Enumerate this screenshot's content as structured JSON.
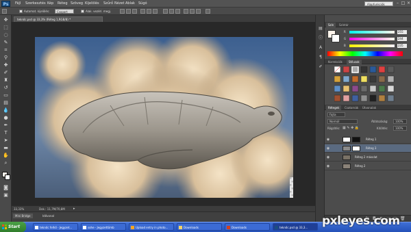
{
  "app": {
    "logo": "Ps",
    "menu": [
      "Fájl",
      "Szerkesztés",
      "Kép",
      "Réteg",
      "Szöveg",
      "Kijelölés",
      "Szűrő",
      "Nézet",
      "Ablak",
      "Súgó"
    ],
    "workspace": "Alapfunkciók"
  },
  "options": {
    "auto_select_label": "Automat. kijelölés:",
    "group_value": "Csoport",
    "transform_label": "Alak. vezérl. megj."
  },
  "document": {
    "tab_title": "teknőc.psd @ 33,3% (Réteg 1,RGB/8) *",
    "zoom": "33,33%",
    "doc_info": "Dok.: 11,7M/70,8M"
  },
  "bottom_tabs": [
    "Mini Bridge",
    "Idővonal"
  ],
  "color_panel": {
    "tabs": [
      "Szín",
      "Színtár"
    ],
    "channels": [
      {
        "label": "R",
        "value": "255"
      },
      {
        "label": "G",
        "value": "244"
      },
      {
        "label": "B",
        "value": "235"
      }
    ],
    "foreground": "#fff4eb"
  },
  "styles_panel": {
    "tabs": [
      "Korrekciók",
      "Stílusok"
    ]
  },
  "layers_panel": {
    "tabs": [
      "Rétegek",
      "Csatornák",
      "Útvonalak"
    ],
    "kind_label": "Fajta",
    "blend_mode": "Normál",
    "opacity_label": "Átlátszóság:",
    "opacity_value": "100%",
    "lock_label": "Rögzítés:",
    "fill_label": "Kitöltés:",
    "fill_value": "100%",
    "layers": [
      {
        "name": "Réteg 1",
        "visible": true,
        "selected": false
      },
      {
        "name": "Réteg 3",
        "visible": true,
        "selected": true
      },
      {
        "name": "Réteg 2 másolat",
        "visible": true,
        "selected": false
      },
      {
        "name": "Réteg 2",
        "visible": true,
        "selected": false
      }
    ]
  },
  "taskbar": {
    "start_label": "Start",
    "tasks": [
      "teknőc felhő - Jegyzet...",
      "sohe - Jegyzettömb",
      "Upload entry in photo...",
      "Downloads",
      "Downloads",
      "teknőc.psd @ 33,3..."
    ]
  },
  "watermark": "pxleyes.com"
}
